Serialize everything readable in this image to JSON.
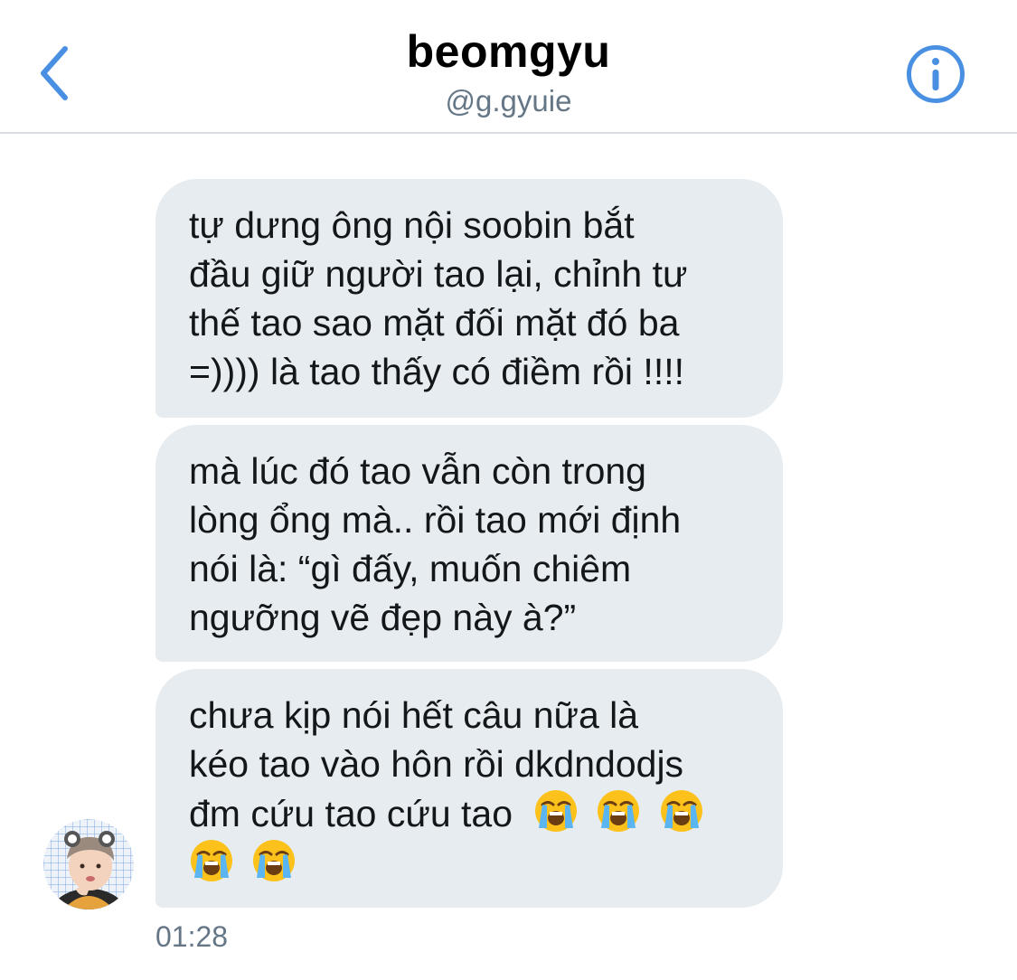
{
  "header": {
    "title": "beomgyu",
    "handle": "@g.gyuie"
  },
  "messages": [
    {
      "lines": [
        "tự dưng ông nội soobin bắt",
        "đầu giữ người tao lại, chỉnh tư",
        "thế tao sao mặt đối mặt đó ba",
        "=)))) là tao thấy có điềm rồi !!!!"
      ]
    },
    {
      "lines": [
        "mà lúc đó tao vẫn còn trong",
        "lòng ổng mà.. rồi tao mới định",
        "nói là: “gì đấy, muốn chiêm",
        "ngưỡng vẽ đẹp này à?”"
      ]
    },
    {
      "lines": [
        "chưa kịp nói hết câu nữa là",
        "kéo tao vào hôn rồi dkdndodjs",
        "đm cứu tao cứu tao"
      ],
      "emojis": [
        "loudly-crying-face",
        "loudly-crying-face",
        "loudly-crying-face",
        "loudly-crying-face",
        "loudly-crying-face"
      ]
    }
  ],
  "timestamp": "01:28",
  "colors": {
    "accent": "#4a90e2",
    "bubble": "#e6ecf0",
    "secondary_text": "#657786",
    "divider": "#d8dde3"
  }
}
